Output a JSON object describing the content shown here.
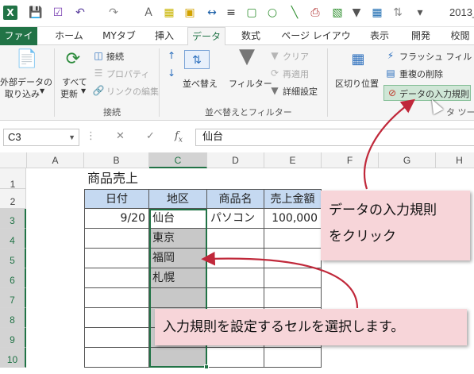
{
  "window": {
    "title": "2013_"
  },
  "quick_access": {
    "icons": [
      "excel-logo",
      "save",
      "checkbox",
      "undo",
      "redo",
      "text",
      "table",
      "shapes",
      "chart",
      "pivot",
      "circle",
      "print",
      "filter",
      "format",
      "grid"
    ]
  },
  "ribbon_tabs": [
    "ファイル",
    "ホーム",
    "MYタブ",
    "挿入",
    "データ",
    "数式",
    "ページ レイアウト",
    "表示",
    "開発",
    "校閲"
  ],
  "active_tab": "データ",
  "ribbon": {
    "external_data": {
      "label_line1": "外部データの",
      "label_line2": "取り込み"
    },
    "refresh_all": {
      "label_line1": "すべて",
      "label_line2": "更新"
    },
    "connections": {
      "connect": "接続",
      "properties": "プロパティ",
      "edit_links": "リンクの編集",
      "group": "接続"
    },
    "sort_filter": {
      "sort": "並べ替え",
      "filter": "フィルター",
      "clear": "クリア",
      "reapply": "再適用",
      "advanced": "詳細設定",
      "group": "並べ替えとフィルター"
    },
    "data_tools": {
      "text_to_columns": "区切り位置",
      "flash_fill": "フラッシュ フィル",
      "remove_duplicates": "重複の削除",
      "data_validation": "データの入力規則",
      "group_partial": "タ ツール"
    }
  },
  "formula_bar": {
    "name_box": "C3",
    "content": "仙台"
  },
  "sheet": {
    "columns": [
      "A",
      "B",
      "C",
      "D",
      "E",
      "F",
      "G",
      "H"
    ],
    "rows": [
      "1",
      "2",
      "3",
      "4",
      "5",
      "6",
      "7",
      "8",
      "9",
      "10"
    ],
    "title": "商品売上",
    "headers": [
      "日付",
      "地区",
      "商品名",
      "売上金額"
    ],
    "row3": {
      "date": "9/20",
      "region": "仙台",
      "product": "パソコン",
      "amount": "100,000"
    },
    "regions": [
      "東京",
      "福岡",
      "札幌"
    ]
  },
  "callouts": {
    "step1_line1": "データの入力規則",
    "step1_line2": "をクリック",
    "step2": "入力規則を設定するセルを選択します。"
  }
}
